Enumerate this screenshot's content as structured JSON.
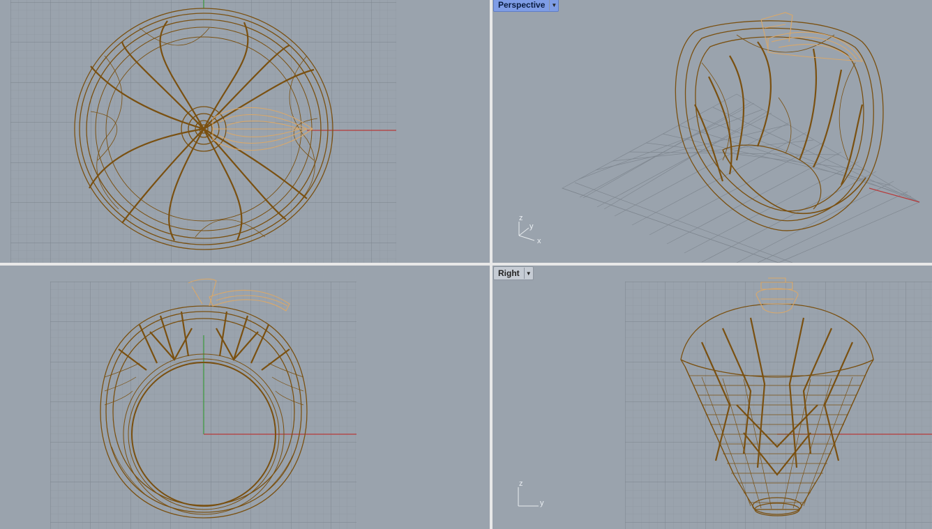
{
  "viewports": {
    "top": {
      "label": ""
    },
    "perspective": {
      "label": "Perspective",
      "active": true
    },
    "front": {
      "label": ""
    },
    "right": {
      "label": "Right"
    }
  },
  "axis_labels": {
    "perspective": {
      "z": "z",
      "y": "y",
      "x": "x"
    },
    "right": {
      "z": "z",
      "y": "y"
    }
  },
  "colors": {
    "viewport_bg": "#9aa3ad",
    "grid_minor": "#8b939c",
    "grid_major": "#7b838c",
    "wire_dark": "#7a5010",
    "wire_light": "#d9a86a",
    "x_axis": "#b73a3a",
    "y_axis": "#3a9a3a",
    "active_tab": "#7f9de6"
  },
  "icons": {
    "dropdown": "chevron-down-icon"
  }
}
